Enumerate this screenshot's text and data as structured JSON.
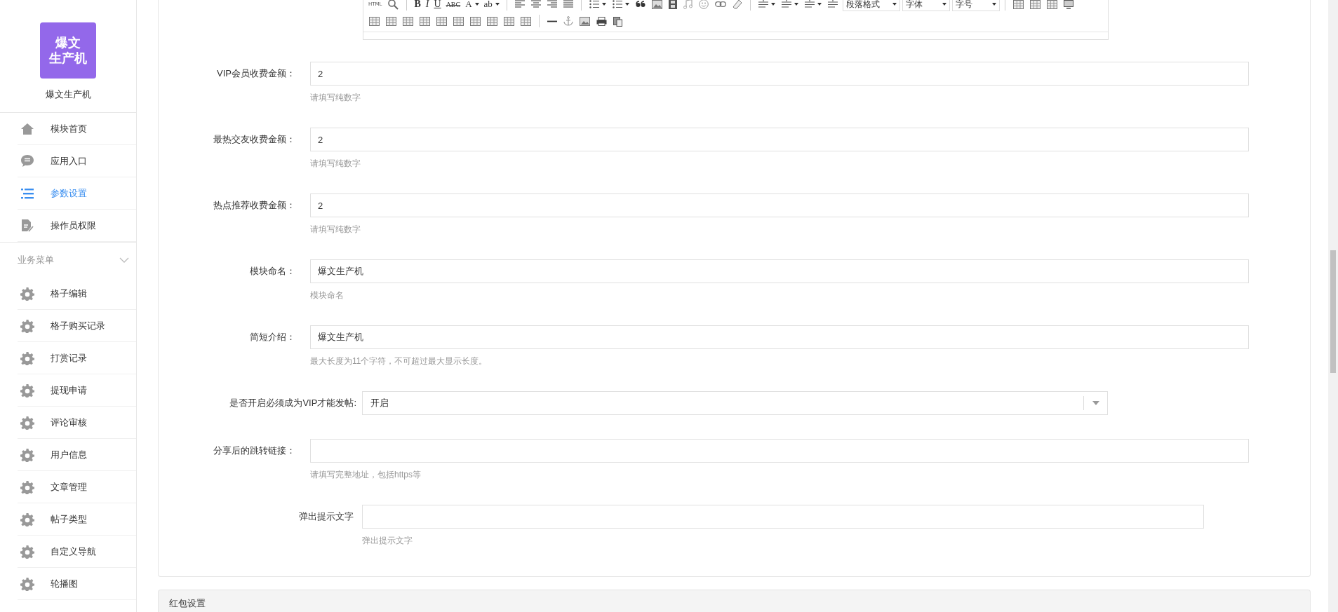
{
  "sidebar": {
    "logo_lines": [
      "爆文",
      "生产机"
    ],
    "app_name": "爆文生产机",
    "items": [
      {
        "kind": "home",
        "label": "模块首页",
        "selected": false
      },
      {
        "kind": "chat",
        "label": "应用入口",
        "selected": false
      },
      {
        "kind": "list",
        "label": "参数设置",
        "selected": true
      },
      {
        "kind": "doc",
        "label": "操作员权限",
        "selected": false
      }
    ],
    "section": {
      "title": "业务菜单",
      "expanded": true,
      "items": [
        {
          "kind": "gear",
          "label": "格子编辑",
          "selected": false
        },
        {
          "kind": "gear",
          "label": "格子购买记录",
          "selected": false
        },
        {
          "kind": "gear",
          "label": "打赏记录",
          "selected": false
        },
        {
          "kind": "gear",
          "label": "提现申请",
          "selected": false
        },
        {
          "kind": "gear",
          "label": "评论审核",
          "selected": false
        },
        {
          "kind": "gear",
          "label": "用户信息",
          "selected": false
        },
        {
          "kind": "gear",
          "label": "文章管理",
          "selected": false
        },
        {
          "kind": "gear",
          "label": "帖子类型",
          "selected": false
        },
        {
          "kind": "gear",
          "label": "自定义导航",
          "selected": false
        },
        {
          "kind": "gear",
          "label": "轮播图",
          "selected": false
        }
      ]
    }
  },
  "editor": {
    "toolbar": [
      [
        {
          "kind": "html",
          "label": "HTML"
        },
        {
          "kind": "search"
        },
        {
          "kind": "sep"
        },
        {
          "kind": "bold",
          "label": "B"
        },
        {
          "kind": "italic",
          "label": "I"
        },
        {
          "kind": "underline",
          "label": "U"
        },
        {
          "kind": "strike",
          "label": "ABC"
        },
        {
          "kind": "glyph",
          "label": "A",
          "dropdown": true
        },
        {
          "kind": "glyph",
          "label": "ab",
          "dropdown": true
        },
        {
          "kind": "sep"
        },
        {
          "kind": "align-left"
        },
        {
          "kind": "align-center"
        },
        {
          "kind": "align-right"
        },
        {
          "kind": "align-justify"
        },
        {
          "kind": "sep"
        },
        {
          "kind": "olist",
          "dropdown": true
        },
        {
          "kind": "ulist",
          "dropdown": true
        },
        {
          "kind": "quote"
        },
        {
          "kind": "image"
        },
        {
          "kind": "film"
        },
        {
          "kind": "music"
        },
        {
          "kind": "smiley"
        },
        {
          "kind": "link"
        },
        {
          "kind": "eraser"
        },
        {
          "kind": "sep"
        },
        {
          "kind": "spacing",
          "dropdown": true
        },
        {
          "kind": "spacing",
          "dropdown": true
        },
        {
          "kind": "spacing",
          "dropdown": true
        },
        {
          "kind": "indent"
        },
        {
          "kind": "combo",
          "label": "段落格式"
        },
        {
          "kind": "combo",
          "label": "字体"
        },
        {
          "kind": "combo",
          "label": "字号"
        },
        {
          "kind": "sep"
        },
        {
          "kind": "table"
        },
        {
          "kind": "table"
        },
        {
          "kind": "table"
        },
        {
          "kind": "monitor"
        }
      ],
      [
        {
          "kind": "table"
        },
        {
          "kind": "table"
        },
        {
          "kind": "table"
        },
        {
          "kind": "table"
        },
        {
          "kind": "table"
        },
        {
          "kind": "table"
        },
        {
          "kind": "table"
        },
        {
          "kind": "table"
        },
        {
          "kind": "table"
        },
        {
          "kind": "table"
        },
        {
          "kind": "sep"
        },
        {
          "kind": "rule"
        },
        {
          "kind": "anchor"
        },
        {
          "kind": "frame"
        },
        {
          "kind": "print"
        },
        {
          "kind": "paste"
        }
      ]
    ]
  },
  "form": {
    "rows": [
      {
        "kind": "text",
        "label": "VIP会员收费金额：",
        "value": "2",
        "help": "请填写纯数字"
      },
      {
        "kind": "text",
        "label": "最热交友收费金额：",
        "value": "2",
        "help": "请填写纯数字"
      },
      {
        "kind": "text",
        "label": "热点推荐收费金额：",
        "value": "2",
        "help": "请填写纯数字"
      },
      {
        "kind": "text",
        "label": "模块命名：",
        "value": "爆文生产机",
        "help": "模块命名"
      },
      {
        "kind": "text",
        "label": "简短介绍：",
        "value": "爆文生产机",
        "help": "最大长度为11个字符，不可超过最大显示长度。"
      },
      {
        "kind": "select",
        "label": "是否开启必须成为VIP才能发帖:",
        "value": "开启"
      },
      {
        "kind": "text",
        "label": "分享后的跳转链接：",
        "help": "请填写完整地址，包括https等"
      },
      {
        "kind": "plain",
        "label": "弹出提示文字",
        "help": "弹出提示文字"
      }
    ]
  },
  "next_panel": {
    "title": "红包设置"
  }
}
